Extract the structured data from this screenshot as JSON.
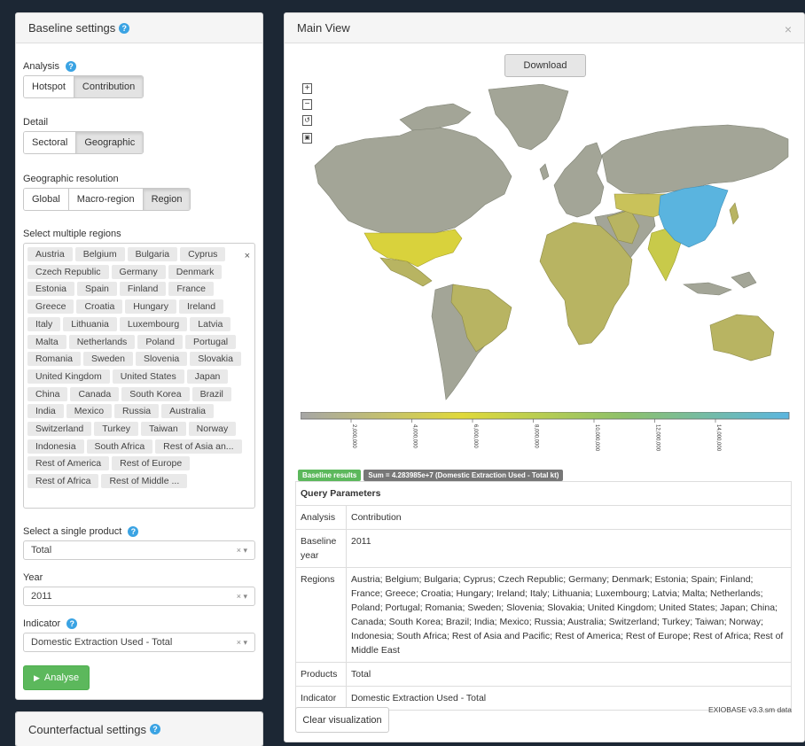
{
  "baseline": {
    "title": "Baseline settings",
    "help_icon": "question-circle-icon",
    "analysis": {
      "label": "Analysis",
      "options": [
        "Hotspot",
        "Contribution"
      ],
      "active": "Contribution"
    },
    "detail": {
      "label": "Detail",
      "options": [
        "Sectoral",
        "Geographic"
      ],
      "active": "Geographic"
    },
    "resolution": {
      "label": "Geographic resolution",
      "options": [
        "Global",
        "Macro-region",
        "Region"
      ],
      "active": "Region"
    },
    "regions": {
      "label": "Select multiple regions",
      "clear": "×",
      "tags": [
        "Austria",
        "Belgium",
        "Bulgaria",
        "Cyprus",
        "Czech Republic",
        "Germany",
        "Denmark",
        "Estonia",
        "Spain",
        "Finland",
        "France",
        "Greece",
        "Croatia",
        "Hungary",
        "Ireland",
        "Italy",
        "Lithuania",
        "Luxembourg",
        "Latvia",
        "Malta",
        "Netherlands",
        "Poland",
        "Portugal",
        "Romania",
        "Sweden",
        "Slovenia",
        "Slovakia",
        "United Kingdom",
        "United States",
        "Japan",
        "China",
        "Canada",
        "South Korea",
        "Brazil",
        "India",
        "Mexico",
        "Russia",
        "Australia",
        "Switzerland",
        "Turkey",
        "Taiwan",
        "Norway",
        "Indonesia",
        "South Africa",
        "Rest of Asia an...",
        "Rest of America",
        "Rest of Europe",
        "Rest of Africa",
        "Rest of Middle ..."
      ]
    },
    "product": {
      "label": "Select a single product",
      "value": "Total",
      "controls": "× ▾"
    },
    "year": {
      "label": "Year",
      "value": "2011",
      "controls": "× ▾"
    },
    "indicator": {
      "label": "Indicator",
      "value": "Domestic Extraction Used - Total",
      "controls": "× ▾"
    },
    "analyse_button": "Analyse",
    "play_icon": "play-icon"
  },
  "counterfactual": {
    "title": "Counterfactual settings"
  },
  "main": {
    "title": "Main View",
    "close": "×",
    "download": "Download",
    "zoom": [
      "+",
      "−",
      "↺",
      "▣"
    ],
    "legend": {
      "ticks": [
        "2,000,000",
        "4,000,000",
        "6,000,000",
        "8,000,000",
        "10,000,000",
        "12,000,000",
        "14,000,000"
      ],
      "gradient": [
        "#a6a6a6",
        "#e0d93a",
        "#8ec16a",
        "#5bb6e0"
      ]
    },
    "badges": {
      "results": "Baseline results",
      "sum": "Sum = 4.283985e+7 (Domestic Extraction Used - Total kt)"
    },
    "query": {
      "header": "Query Parameters",
      "rows": [
        {
          "key": "Analysis",
          "value": "Contribution"
        },
        {
          "key": "Baseline year",
          "value": "2011"
        },
        {
          "key": "Regions",
          "value": "Austria; Belgium; Bulgaria; Cyprus; Czech Republic; Germany; Denmark; Estonia; Spain; Finland; France; Greece; Croatia; Hungary; Ireland; Italy; Lithuania; Luxembourg; Latvia; Malta; Netherlands; Poland; Portugal; Romania; Sweden; Slovenia; Slovakia; United Kingdom; United States; Japan; China; Canada; South Korea; Brazil; India; Mexico; Russia; Australia; Switzerland; Turkey; Taiwan; Norway; Indonesia; South Africa; Rest of Asia and Pacific; Rest of America; Rest of Europe; Rest of Africa; Rest of Middle East"
        },
        {
          "key": "Products",
          "value": "Total"
        },
        {
          "key": "Indicator",
          "value": "Domestic Extraction Used - Total"
        }
      ]
    },
    "clear_button": "Clear visualization",
    "version": "EXIOBASE v3.3.sm data"
  },
  "colors": {
    "grey_region": "#a3a597",
    "olive_region": "#b8b462",
    "usa": "#d9d23c",
    "china": "#5ab4df",
    "india": "#c8ca4a",
    "analyse_green": "#5cb85c",
    "badge_green": "#5cb85c",
    "badge_grey": "#777777"
  }
}
